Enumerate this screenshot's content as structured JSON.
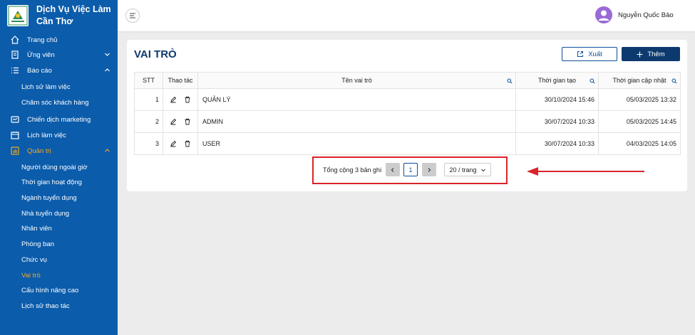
{
  "brand": {
    "title": "Dịch Vụ Việc Làm Cần Thơ"
  },
  "sidebar": {
    "items": [
      {
        "label": "Trang chủ",
        "icon": "home-icon"
      },
      {
        "label": "Ứng viên",
        "icon": "resume-icon",
        "chevron": "down"
      },
      {
        "label": "Báo cáo",
        "icon": "list-icon",
        "chevron": "up"
      },
      {
        "label": "Lịch sử làm việc",
        "sub": true
      },
      {
        "label": "Chăm sóc khách hàng",
        "sub": true
      },
      {
        "label": "Chiến dịch marketing",
        "icon": "campaign-icon"
      },
      {
        "label": "Lịch làm việc",
        "icon": "calendar-icon"
      },
      {
        "label": "Quản trị",
        "icon": "admin-icon",
        "chevron": "up",
        "active": true
      },
      {
        "label": "Người dùng ngoài giờ",
        "sub": true
      },
      {
        "label": "Thời gian hoạt động",
        "sub": true
      },
      {
        "label": "Ngành tuyển dụng",
        "sub": true
      },
      {
        "label": "Nhà tuyển dụng",
        "sub": true
      },
      {
        "label": "Nhân viên",
        "sub": true
      },
      {
        "label": "Phòng ban",
        "sub": true
      },
      {
        "label": "Chức vụ",
        "sub": true
      },
      {
        "label": "Vai trò",
        "sub": true,
        "active": true
      },
      {
        "label": "Cấu hình nâng cao",
        "sub": true
      },
      {
        "label": "Lịch sử thao tác",
        "sub": true
      }
    ]
  },
  "header": {
    "user_name": "Nguyễn Quốc Bảo"
  },
  "main": {
    "title": "VAI TRÒ",
    "export_label": "Xuất",
    "add_label": "Thêm",
    "columns": [
      "STT",
      "Thao tác",
      "Tên vai trò",
      "Thời gian tạo",
      "Thời gian cập nhật"
    ],
    "rows": [
      {
        "stt": "1",
        "name": "QUẢN LÝ",
        "created": "30/10/2024 15:46",
        "updated": "05/03/2025 13:32"
      },
      {
        "stt": "2",
        "name": "ADMIN",
        "created": "30/07/2024 10:33",
        "updated": "05/03/2025 14:45"
      },
      {
        "stt": "3",
        "name": "USER",
        "created": "30/07/2024 10:33",
        "updated": "04/03/2025 14:05"
      }
    ],
    "pagination": {
      "total_label": "Tổng cộng 3 bản ghi",
      "current_page": "1",
      "page_size": "20 / trang"
    }
  },
  "colors": {
    "sidebar": "#0b5cab",
    "active": "#f5a623",
    "primary": "#0d3a6e",
    "highlight": "#d9242a"
  }
}
